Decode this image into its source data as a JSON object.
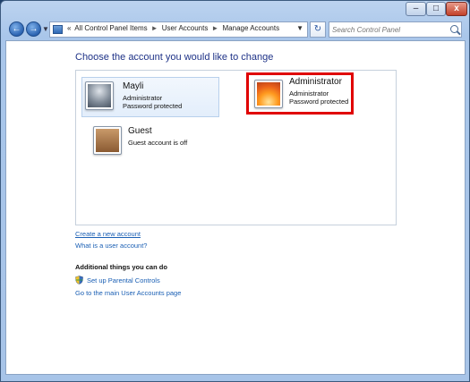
{
  "window": {
    "minimize_glyph": "–",
    "maximize_glyph": "□",
    "close_glyph": "x"
  },
  "nav": {
    "back_glyph": "←",
    "forward_glyph": "→",
    "history_dropdown_glyph": "▼",
    "breadcrumbs": [
      "All Control Panel Items",
      "User Accounts",
      "Manage Accounts"
    ],
    "breadcrumb_prefix": "«",
    "breadcrumb_separator": "►",
    "address_dropdown_glyph": "▼",
    "refresh_glyph": "↻",
    "search_placeholder": "Search Control Panel"
  },
  "main": {
    "heading": "Choose the account you would like to change",
    "accounts": [
      {
        "name": "Mayli",
        "type": "Administrator",
        "status": "Password protected",
        "picture": "robot-figure"
      },
      {
        "name": "Administrator",
        "type": "Administrator",
        "status": "Password protected",
        "picture": "orange-flower",
        "highlighted": true
      },
      {
        "name": "Guest",
        "type": "Guest account is off",
        "status": "",
        "picture": "briefcase"
      }
    ],
    "links": {
      "create": "Create a new account",
      "what_is": "What is a user account?"
    },
    "additional": {
      "heading": "Additional things you can do",
      "parental": "Set up Parental Controls",
      "main_page": "Go to the main User Accounts page"
    }
  },
  "colors": {
    "highlight_border": "#e00000",
    "heading_text": "#1e3287",
    "link_text": "#1a5fb4"
  }
}
